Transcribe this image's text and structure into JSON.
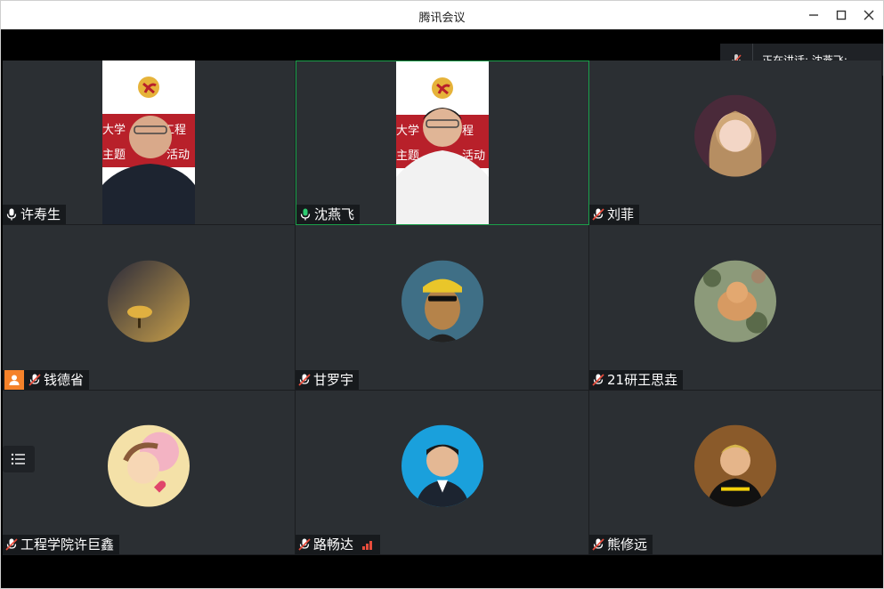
{
  "window": {
    "title": "腾讯会议"
  },
  "speaking": {
    "text": "正在讲话: 沈燕飞;"
  },
  "colors": {
    "tile_bg": "#2b2f33",
    "active_border": "#1aa04a",
    "mic_on": "#2ecc71",
    "host_badge": "#f5822a"
  },
  "participants": [
    {
      "name": "许寿生",
      "mic": "on",
      "view": "video"
    },
    {
      "name": "沈燕飞",
      "mic": "speaking",
      "view": "video",
      "active": true
    },
    {
      "name": "刘菲",
      "mic": "muted",
      "view": "avatar"
    },
    {
      "name": "钱德省",
      "mic": "muted",
      "view": "avatar",
      "host": true
    },
    {
      "name": "甘罗宇",
      "mic": "muted",
      "view": "avatar"
    },
    {
      "name": "21研王思垚",
      "mic": "muted",
      "view": "avatar"
    },
    {
      "name": "工程学院许巨鑫",
      "mic": "muted",
      "view": "avatar"
    },
    {
      "name": "路畅达",
      "mic": "muted",
      "view": "avatar",
      "signal": "signal-bars-icon"
    },
    {
      "name": "熊修远",
      "mic": "muted",
      "view": "avatar"
    }
  ]
}
